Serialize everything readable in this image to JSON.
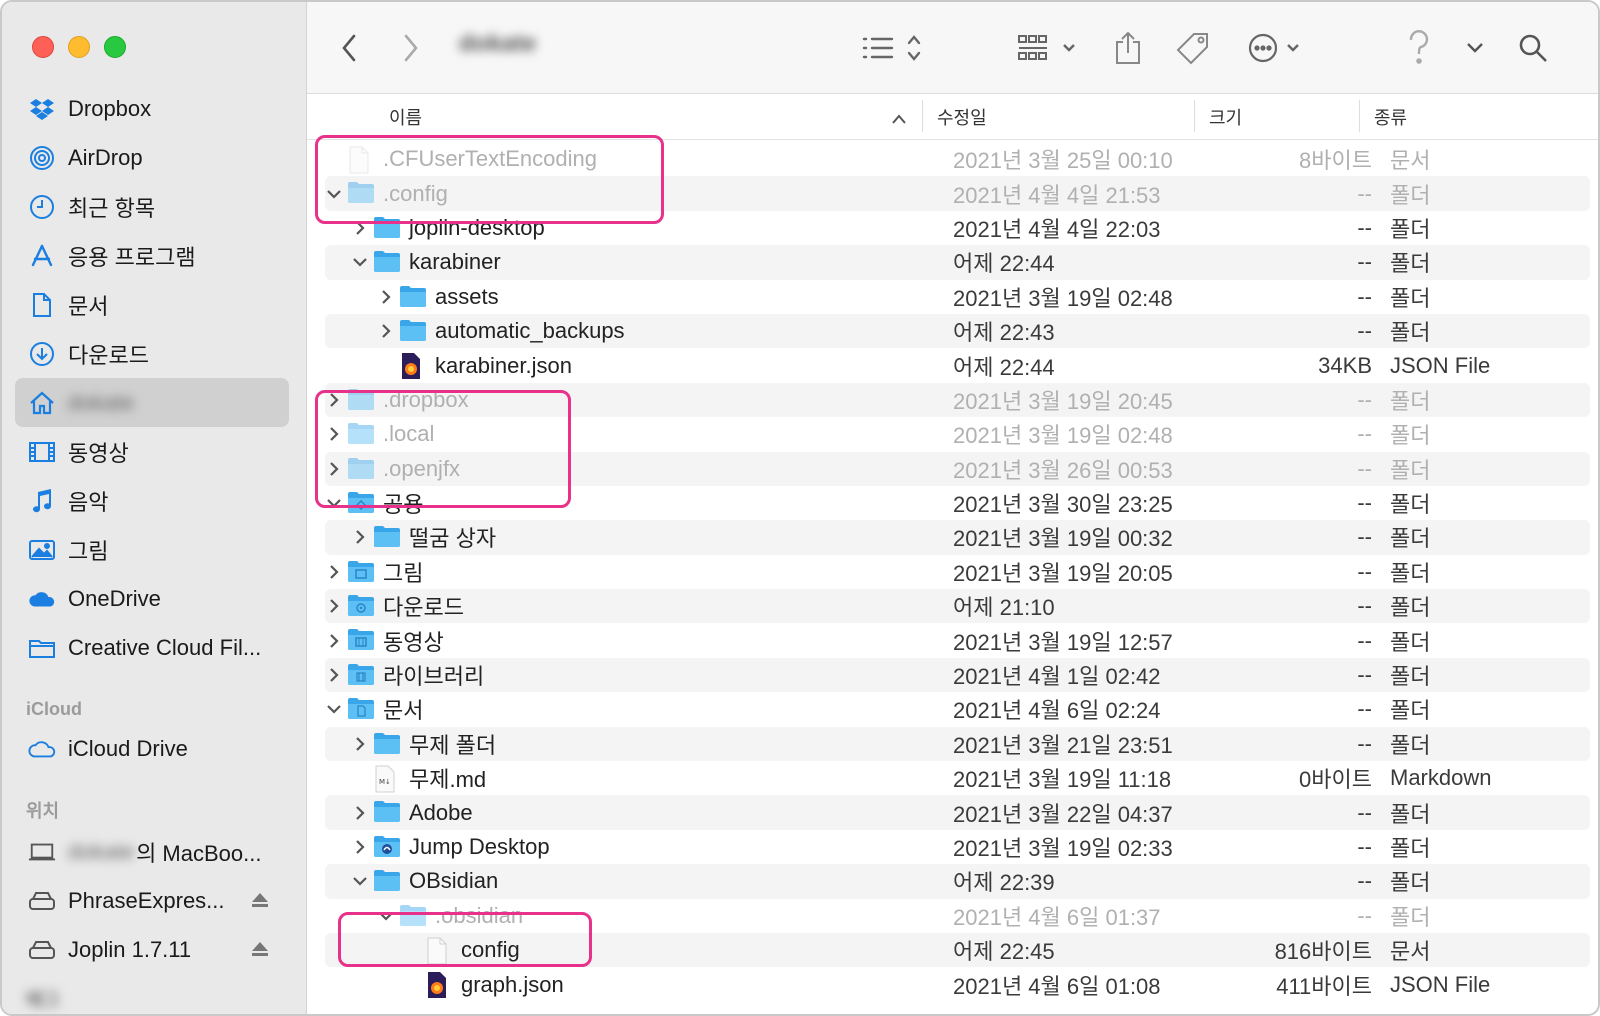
{
  "window": {
    "title": "dokate"
  },
  "sidebar": {
    "favorites": [
      {
        "label": "Dropbox",
        "icon": "dropbox-icon"
      },
      {
        "label": "AirDrop",
        "icon": "airdrop-icon"
      },
      {
        "label": "최근 항목",
        "icon": "clock-icon"
      },
      {
        "label": "응용 프로그램",
        "icon": "applications-icon"
      },
      {
        "label": "문서",
        "icon": "document-icon"
      },
      {
        "label": "다운로드",
        "icon": "download-icon"
      },
      {
        "label": "dokate",
        "icon": "home-icon"
      },
      {
        "label": "동영상",
        "icon": "film-icon"
      },
      {
        "label": "음악",
        "icon": "music-icon"
      },
      {
        "label": "그림",
        "icon": "picture-icon"
      },
      {
        "label": "OneDrive",
        "icon": "onedrive-icon"
      },
      {
        "label": "Creative Cloud Fil...",
        "icon": "folder-icon"
      }
    ],
    "icloud_header": "iCloud",
    "icloud": [
      {
        "label": "iCloud Drive",
        "icon": "cloud-icon"
      }
    ],
    "locations_header": "위치",
    "locations": [
      {
        "label_blur": "dokate",
        "label": "의 MacBoo...",
        "icon": "laptop-icon"
      },
      {
        "label": "PhraseExpres...",
        "icon": "drive-icon"
      },
      {
        "label": "Joplin 1.7.11",
        "icon": "drive-icon"
      }
    ],
    "tags_header": "태그"
  },
  "columns": {
    "name": "이름",
    "modified": "수정일",
    "size": "크기",
    "kind": "종류"
  },
  "rows": [
    {
      "name": ".CFUserTextEncoding",
      "date": "2021년 3월 25일 00:10",
      "size": "8바이트",
      "kind": "문서"
    },
    {
      "name": ".config",
      "date": "2021년 4월 4일 21:53",
      "size": "--",
      "kind": "폴더"
    },
    {
      "name": "joplin-desktop",
      "date": "2021년 4월 4일 22:03",
      "size": "--",
      "kind": "폴더"
    },
    {
      "name": "karabiner",
      "date": "어제 22:44",
      "size": "--",
      "kind": "폴더"
    },
    {
      "name": "assets",
      "date": "2021년 3월 19일 02:48",
      "size": "--",
      "kind": "폴더"
    },
    {
      "name": "automatic_backups",
      "date": "어제 22:43",
      "size": "--",
      "kind": "폴더"
    },
    {
      "name": "karabiner.json",
      "date": "어제 22:44",
      "size": "34KB",
      "kind": "JSON File"
    },
    {
      "name": ".dropbox",
      "date": "2021년 3월 19일 20:45",
      "size": "--",
      "kind": "폴더"
    },
    {
      "name": ".local",
      "date": "2021년 3월 19일 02:48",
      "size": "--",
      "kind": "폴더"
    },
    {
      "name": ".openjfx",
      "date": "2021년 3월 26일 00:53",
      "size": "--",
      "kind": "폴더"
    },
    {
      "name": "공용",
      "date": "2021년 3월 30일 23:25",
      "size": "--",
      "kind": "폴더"
    },
    {
      "name": "떨굼 상자",
      "date": "2021년 3월 19일 00:32",
      "size": "--",
      "kind": "폴더"
    },
    {
      "name": "그림",
      "date": "2021년 3월 19일 20:05",
      "size": "--",
      "kind": "폴더"
    },
    {
      "name": "다운로드",
      "date": "어제 21:10",
      "size": "--",
      "kind": "폴더"
    },
    {
      "name": "동영상",
      "date": "2021년 3월 19일 12:57",
      "size": "--",
      "kind": "폴더"
    },
    {
      "name": "라이브러리",
      "date": "2021년 4월 1일 02:42",
      "size": "--",
      "kind": "폴더"
    },
    {
      "name": "문서",
      "date": "2021년 4월 6일 02:24",
      "size": "--",
      "kind": "폴더"
    },
    {
      "name": "무제 폴더",
      "date": "2021년 3월 21일 23:51",
      "size": "--",
      "kind": "폴더"
    },
    {
      "name": "무제.md",
      "date": "2021년 3월 19일 11:18",
      "size": "0바이트",
      "kind": "Markdown"
    },
    {
      "name": "Adobe",
      "date": "2021년 3월 22일 04:37",
      "size": "--",
      "kind": "폴더"
    },
    {
      "name": "Jump Desktop",
      "date": "2021년 3월 19일 02:33",
      "size": "--",
      "kind": "폴더"
    },
    {
      "name": "OBsidian",
      "date": "어제 22:39",
      "size": "--",
      "kind": "폴더"
    },
    {
      "name": ".obsidian",
      "date": "2021년 4월 6일 01:37",
      "size": "--",
      "kind": "폴더"
    },
    {
      "name": "config",
      "date": "어제 22:45",
      "size": "816바이트",
      "kind": "문서"
    },
    {
      "name": "graph.json",
      "date": "2021년 4월 6일 01:08",
      "size": "411바이트",
      "kind": "JSON File"
    }
  ],
  "colors": {
    "highlight": "#e8318a",
    "folder": "#4ab3ef",
    "accent": "#1a7fe0"
  }
}
